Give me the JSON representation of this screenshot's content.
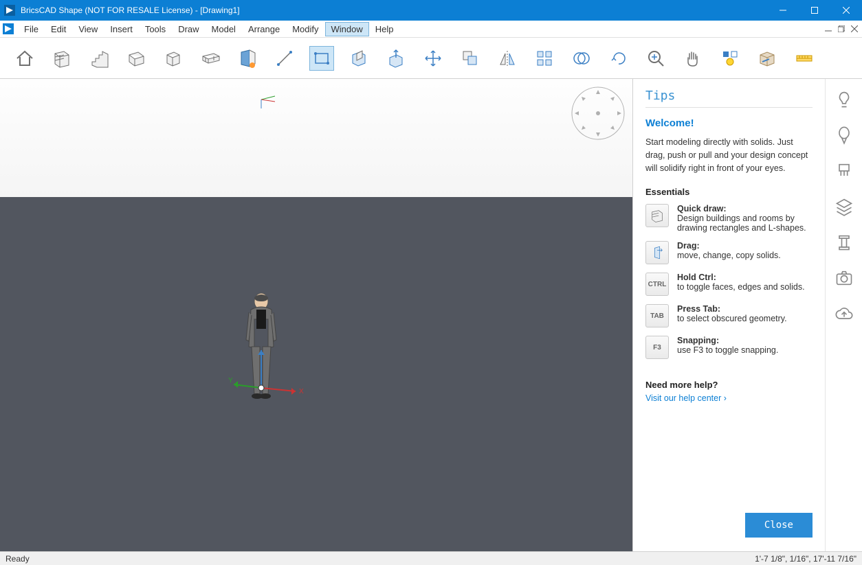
{
  "titlebar": {
    "title": "BricsCAD Shape (NOT FOR RESALE License) - [Drawing1]"
  },
  "menu": {
    "items": [
      "File",
      "Edit",
      "View",
      "Insert",
      "Tools",
      "Draw",
      "Model",
      "Arrange",
      "Modify",
      "Window",
      "Help"
    ]
  },
  "toolbar": {
    "tools": [
      "home",
      "wall",
      "stairs",
      "floor",
      "box",
      "column",
      "wall-left",
      "line",
      "rectangle",
      "push-pull",
      "extrude",
      "move",
      "copy",
      "mirror",
      "array",
      "boolean",
      "rotate",
      "zoom",
      "pan",
      "light",
      "materials",
      "measure"
    ]
  },
  "tips": {
    "title": "Tips",
    "welcome": "Welcome!",
    "intro": "Start modeling directly with solids. Just drag, push or pull and your design concept will solidify right in front of your eyes.",
    "essentials_title": "Essentials",
    "essentials": [
      {
        "icon": "quickdraw",
        "label": "",
        "title": "Quick draw:",
        "text": "Design buildings and rooms by drawing rectangles and L-shapes."
      },
      {
        "icon": "drag",
        "label": "",
        "title": "Drag:",
        "text": "move, change, copy solids."
      },
      {
        "icon": "key",
        "label": "CTRL",
        "title": "Hold Ctrl:",
        "text": "to toggle faces, edges and solids."
      },
      {
        "icon": "key",
        "label": "TAB",
        "title": "Press Tab:",
        "text": "to select obscured geometry."
      },
      {
        "icon": "key",
        "label": "F3",
        "title": "Snapping:",
        "text": "use F3 to toggle snapping."
      }
    ],
    "help_title": "Need more help?",
    "help_link": "Visit our help center ›",
    "close": "Close"
  },
  "rail": {
    "items": [
      "bulb",
      "balloon",
      "brush",
      "layers",
      "column",
      "camera",
      "cloud"
    ]
  },
  "status": {
    "left": "Ready",
    "right": "1'-7 1/8\", 1/16\", 17'-11 7/16\""
  }
}
